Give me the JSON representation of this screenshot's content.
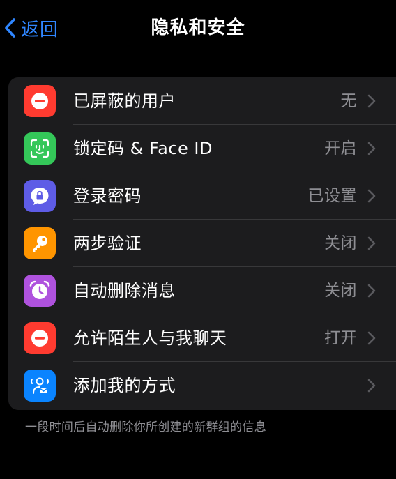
{
  "nav": {
    "back_label": "返回",
    "title": "隐私和安全"
  },
  "rows": [
    {
      "label": "已屏蔽的用户",
      "value": "无",
      "icon": "blocked-icon",
      "color": "#ff3b30"
    },
    {
      "label": "锁定码 & Face ID",
      "value": "开启",
      "icon": "face-id-icon",
      "color": "#34c759"
    },
    {
      "label": "登录密码",
      "value": "已设置",
      "icon": "lock-bubble-icon",
      "color": "#5e5ce6"
    },
    {
      "label": "两步验证",
      "value": "关闭",
      "icon": "key-icon",
      "color": "#ff9500"
    },
    {
      "label": "自动删除消息",
      "value": "关闭",
      "icon": "alarm-clock-icon",
      "color": "#af52de"
    },
    {
      "label": "允许陌生人与我聊天",
      "value": "打开",
      "icon": "blocked-icon",
      "color": "#ff3b30"
    },
    {
      "label": "添加我的方式",
      "value": "",
      "icon": "person-contact-icon",
      "color": "#0a84ff"
    }
  ],
  "footnote": "一段时间后自动删除你所创建的新群组的信息",
  "colors": {
    "accent": "#2f86ff",
    "background": "#000000",
    "card": "#1c1c1e",
    "secondary_text": "#8e8e93"
  }
}
